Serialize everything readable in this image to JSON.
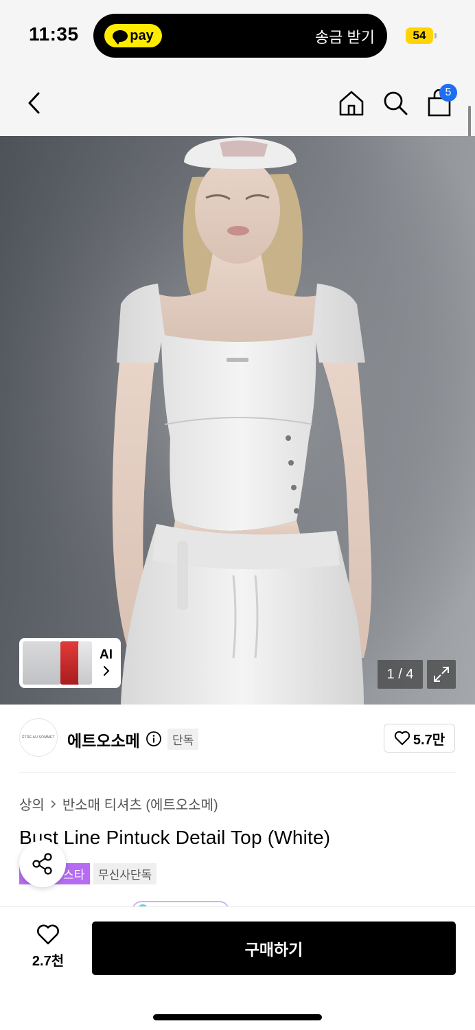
{
  "status_bar": {
    "time": "11:35",
    "pay_label": "pay",
    "pay_action": "송금 받기",
    "battery": "54"
  },
  "nav": {
    "cart_count": "5"
  },
  "gallery": {
    "ai_label": "AI",
    "counter": "1 / 4"
  },
  "brand": {
    "logo_text": "ÊTRE AU SOMMET",
    "name": "에트오소메",
    "exclusive_tag": "단독",
    "likes": "5.7만"
  },
  "product": {
    "breadcrumb": [
      "상의",
      "반소매 티셔츠 (에트오소메)"
    ],
    "title": "Bust Line Pintuck Detail Top (White)",
    "tags": [
      "스타",
      "무신사단독"
    ]
  },
  "bottom_bar": {
    "wish_count": "2.7천",
    "buy_label": "구매하기"
  },
  "colors": {
    "accent_purple": "#b56cf2",
    "badge_blue": "#1f6ef0",
    "pay_yellow": "#ffeb00",
    "battery_yellow": "#ffd400"
  }
}
